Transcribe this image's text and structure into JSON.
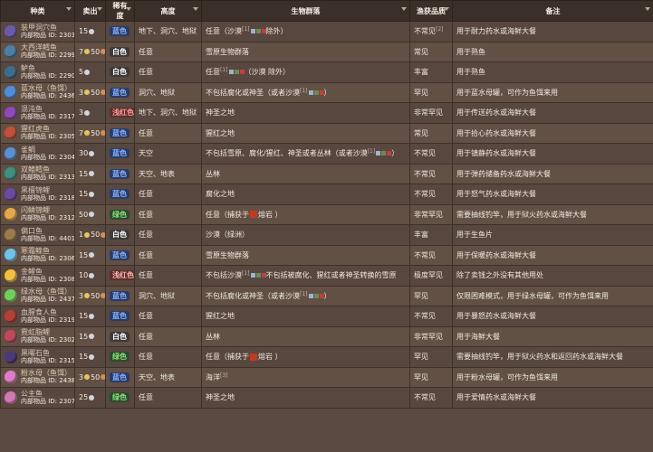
{
  "headers": {
    "type": "种类",
    "sell": "卖出",
    "rarity": "稀有度",
    "height": "高度",
    "biome": "生物群落",
    "quality": "渔获品质",
    "notes": "备注"
  },
  "id_prefix": "内部物品 ID:",
  "rows": [
    {
      "name": "装甲洞穴鱼",
      "id": "2303",
      "sell": "15",
      "rarity": "蓝色",
      "rar_class": "blue",
      "height": "地下、洞穴、地狱",
      "biome": "任意（沙漠",
      "biome_sup": "[1]",
      "biome_tail": "除外）",
      "quality": "不常见",
      "quality_sup": "[2]",
      "notes": "用于耐力药水或海鲜大餐",
      "color": "#6a5ba8"
    },
    {
      "name": "大西洋鳕鱼",
      "id": "2299",
      "sell": "7 50",
      "rarity": "白色",
      "rar_class": "white",
      "height": "任意",
      "biome": "雪原生物群落",
      "biome_sup": "",
      "biome_tail": "",
      "quality": "常见",
      "quality_sup": "",
      "notes": "用于熟鱼",
      "color": "#4a7fa6"
    },
    {
      "name": "鲈鱼",
      "id": "2290",
      "sell": "5",
      "rarity": "白色",
      "rar_class": "white",
      "height": "任意",
      "biome": "任意",
      "biome_sup": "[1]",
      "biome_tail": "（沙漠 除外）",
      "quality": "丰富",
      "quality_sup": "",
      "notes": "用于熟鱼",
      "color": "#3e6c8a"
    },
    {
      "name": "蓝水母（鱼饵）",
      "id": "2436",
      "sell": "3 50",
      "rarity": "蓝色",
      "rar_class": "blue",
      "height": "洞穴、地狱",
      "biome": "不包括腐化或神圣（或者沙漠",
      "biome_sup": "[1]",
      "biome_tail": "）",
      "quality": "罕见",
      "quality_sup": "",
      "notes": "用于蓝水母罐，可作为鱼饵来用",
      "color": "#4f8dd8"
    },
    {
      "name": "混沌鱼",
      "id": "2317",
      "sell": "3",
      "rarity": "浅红色",
      "rar_class": "lred",
      "height": "地下、洞穴、地狱",
      "biome": "神圣之地",
      "biome_sup": "",
      "biome_tail": "",
      "quality": "非常罕见",
      "quality_sup": "",
      "notes": "用于传送药水或海鲜大餐",
      "color": "#8f48b8"
    },
    {
      "name": "猩红虎鱼",
      "id": "2305",
      "sell": "7 50",
      "rarity": "蓝色",
      "rar_class": "blue",
      "height": "任意",
      "biome": "猩红之地",
      "biome_sup": "",
      "biome_tail": "",
      "quality": "常见",
      "quality_sup": "",
      "notes": "用于拾心药水或海鲜大餐",
      "color": "#c0503a"
    },
    {
      "name": "雀鲷",
      "id": "2304",
      "sell": "30",
      "rarity": "蓝色",
      "rar_class": "blue",
      "height": "天空",
      "biome": "不包括雪原、腐化/猩红、神圣或者丛林（或者沙漠",
      "biome_sup": "[1]",
      "biome_tail": "）",
      "quality": "不常见",
      "quality_sup": "",
      "notes": "用于镇静药水或海鲜大餐",
      "color": "#5a8fd2"
    },
    {
      "name": "双鳍鳕鱼",
      "id": "2313",
      "sell": "15",
      "rarity": "蓝色",
      "rar_class": "blue",
      "height": "天空、地表",
      "biome": "丛林",
      "biome_sup": "",
      "biome_tail": "",
      "quality": "不常见",
      "quality_sup": "",
      "notes": "用于弹药储备药水或海鲜大餐",
      "color": "#3e8f7d"
    },
    {
      "name": "黑檀锦鲤",
      "id": "2318",
      "sell": "15",
      "rarity": "蓝色",
      "rar_class": "blue",
      "height": "任意",
      "biome": "腐化之地",
      "biome_sup": "",
      "biome_tail": "",
      "quality": "不常见",
      "quality_sup": "",
      "notes": "用于怒气药水或海鲜大餐",
      "color": "#6b4aa0"
    },
    {
      "name": "闪鳞锦鲤",
      "id": "2312",
      "sell": "50",
      "rarity": "绿色",
      "rar_class": "green",
      "height": "任意",
      "biome": "任意（捕获于",
      "biome_sup": "",
      "biome_tail": "熔岩 ）",
      "quality": "非常罕见",
      "quality_sup": "",
      "notes": "需要抽线钓竿，用于狱火药水或海鲜大餐",
      "color": "#e3a84a"
    },
    {
      "name": "偏口鱼",
      "id": "4401",
      "sell": "1 50",
      "rarity": "白色",
      "rar_class": "white",
      "height": "任意",
      "biome": "沙漠（绿洲）",
      "biome_sup": "",
      "biome_tail": "",
      "quality": "丰富",
      "quality_sup": "",
      "notes": "用于生鱼片",
      "color": "#9c7a4a"
    },
    {
      "name": "寒霜鲦鱼",
      "id": "2306",
      "sell": "15",
      "rarity": "蓝色",
      "rar_class": "blue",
      "height": "任意",
      "biome": "雪原生物群落",
      "biome_sup": "",
      "biome_tail": "",
      "quality": "不常见",
      "quality_sup": "",
      "notes": "用于保暖药水或海鲜大餐",
      "color": "#6ec4e8"
    },
    {
      "name": "金鲤鱼",
      "id": "2308",
      "sell": "10",
      "rarity": "浅红色",
      "rar_class": "lred2",
      "height": "任意",
      "biome": "不包括沙漠",
      "biome_sup": "[1]",
      "biome_tail": "不包括被腐化、猩红或者神圣转换的雪原",
      "quality": "极度罕见",
      "quality_sup": "",
      "notes": "除了卖钱之外没有其他用处",
      "color": "#f0c040"
    },
    {
      "name": "绿水母（鱼饵）",
      "id": "2437",
      "sell": "3 50",
      "rarity": "蓝色",
      "rar_class": "blue",
      "height": "洞穴、地狱",
      "biome": "不包括腐化或神圣（或者沙漠",
      "biome_sup": "[1]",
      "biome_tail": "）",
      "quality": "罕见",
      "quality_sup": "",
      "notes": "仅限困难模式，用于绿水母罐，可作为鱼饵来用",
      "color": "#6fcf5a"
    },
    {
      "name": "血腥食人鱼",
      "id": "2319",
      "sell": "15",
      "rarity": "蓝色",
      "rar_class": "blue",
      "height": "任意",
      "biome": "猩红之地",
      "biome_sup": "",
      "biome_tail": "",
      "quality": "不常见",
      "quality_sup": "",
      "notes": "用于暴怒药水或海鲜大餐",
      "color": "#b34038"
    },
    {
      "name": "霓虹脂鲤",
      "id": "2302",
      "sell": "15",
      "rarity": "白色",
      "rar_class": "white",
      "height": "任意",
      "biome": "丛林",
      "biome_sup": "",
      "biome_tail": "",
      "quality": "非常罕见",
      "quality_sup": "",
      "notes": "用于海鲜大餐",
      "color": "#c0485e"
    },
    {
      "name": "黑曜石鱼",
      "id": "2315",
      "sell": "15",
      "rarity": "绿色",
      "rar_class": "green",
      "height": "任意",
      "biome": "任意（捕获于",
      "biome_sup": "",
      "biome_tail": "熔岩 ）",
      "quality": "罕见",
      "quality_sup": "",
      "notes": "需要抽线钓竿，用于狱火药水和返回药水或海鲜大餐",
      "color": "#4b3a78"
    },
    {
      "name": "粉水母（鱼饵）",
      "id": "2438",
      "sell": "3 50",
      "rarity": "蓝色",
      "rar_class": "blue",
      "height": "天空、地表",
      "biome": "海洋",
      "biome_sup": "[3]",
      "biome_tail": "",
      "quality": "罕见",
      "quality_sup": "",
      "notes": "用于粉水母罐，可作为鱼饵来用",
      "color": "#e07cc7"
    },
    {
      "name": "公主鱼",
      "id": "2307",
      "sell": "25",
      "rarity": "绿色",
      "rar_class": "green",
      "height": "任意",
      "biome": "神圣之地",
      "biome_sup": "",
      "biome_tail": "",
      "quality": "不常见",
      "quality_sup": "",
      "notes": "用于爱情药水或海鲜大餐",
      "color": "#d078b0"
    }
  ]
}
